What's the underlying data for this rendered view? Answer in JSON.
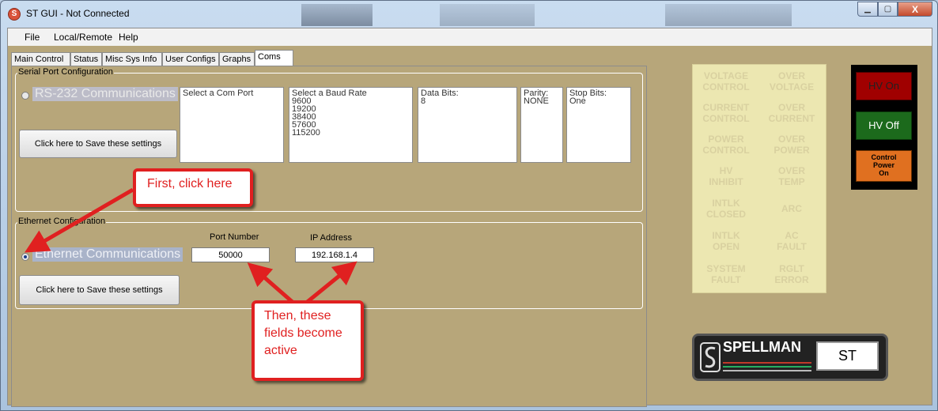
{
  "window": {
    "title": "ST GUI - Not Connected",
    "app_icon_glyph": "S",
    "minimize": "▁",
    "maximize": "▢",
    "close": "X"
  },
  "menu": [
    "File",
    "Local/Remote",
    "Help"
  ],
  "tabs": [
    {
      "label": "Main Control",
      "active": false
    },
    {
      "label": "Status",
      "active": false
    },
    {
      "label": "Misc Sys Info",
      "active": false
    },
    {
      "label": "User Configs",
      "active": false
    },
    {
      "label": "Graphs",
      "active": false
    },
    {
      "label": "Coms",
      "active": true
    }
  ],
  "serial": {
    "group_label": "Serial Port Configuration",
    "radio_label": "RS-232 Communications",
    "save_button": "Click here to Save these settings",
    "com_port": {
      "header": "Select a Com Port",
      "items": []
    },
    "baud_rate": {
      "header": "Select a Baud Rate",
      "items": [
        "9600",
        "19200",
        "38400",
        "57600",
        "115200"
      ]
    },
    "data_bits": {
      "header": "Data Bits:",
      "items": [
        "8"
      ]
    },
    "parity": {
      "header": "Parity:",
      "items": [
        "NONE"
      ]
    },
    "stop_bits": {
      "header": "Stop Bits:",
      "items": [
        "One"
      ]
    }
  },
  "ethernet": {
    "group_label": "Ethernet Configuration",
    "radio_label": "Ethernet Communications",
    "save_button": "Click here to Save these settings",
    "port_label": "Port Number",
    "port_value": "50000",
    "ip_label": "IP Address",
    "ip_value": "192.168.1.4"
  },
  "status_indicators": [
    [
      "VOLTAGE",
      "CONTROL"
    ],
    [
      "OVER",
      "VOLTAGE"
    ],
    [
      "CURRENT",
      "CONTROL"
    ],
    [
      "OVER",
      "CURRENT"
    ],
    [
      "POWER",
      "CONTROL"
    ],
    [
      "OVER",
      "POWER"
    ],
    [
      "HV",
      "INHIBIT"
    ],
    [
      "OVER",
      "TEMP"
    ],
    [
      "INTLK",
      "CLOSED"
    ],
    [
      "ARC"
    ],
    [
      "INTLK",
      "OPEN"
    ],
    [
      "AC",
      "FAULT"
    ],
    [
      "SYSTEM",
      "FAULT"
    ],
    [
      "RGLT",
      "ERROR"
    ]
  ],
  "hv": {
    "on": "HV On",
    "off": "HV Off",
    "control_power": [
      "Control",
      "Power",
      "On"
    ]
  },
  "logo": {
    "brand": "SPELLMAN",
    "model": "ST",
    "mark": "S"
  },
  "callouts": {
    "first": "First, click here",
    "then": [
      "Then, these",
      "fields become",
      "active"
    ]
  },
  "colors": {
    "panel_bg": "#b7a67a",
    "status_panel": "#ece7b1",
    "hv_on": "#a00000",
    "hv_off": "#1c6a1c",
    "control_power": "#e07020",
    "callout_red": "#e02020"
  }
}
